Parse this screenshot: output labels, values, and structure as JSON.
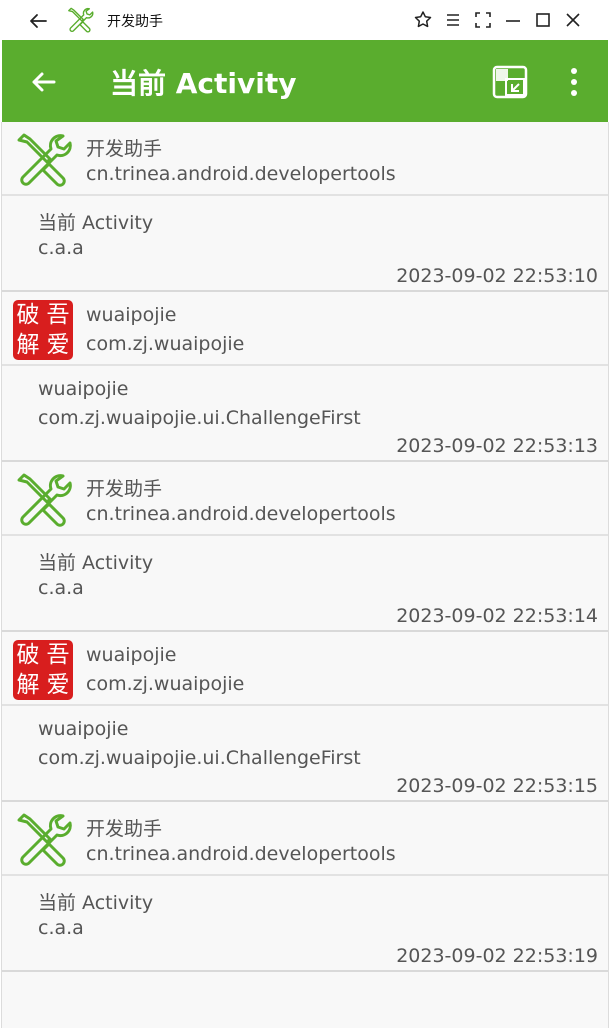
{
  "window": {
    "title": "开发助手",
    "icons": [
      "back-arrow-icon",
      "tools-icon",
      "pin-icon",
      "menu-icon",
      "fullscreen-icon",
      "minimize-icon",
      "maximize-icon",
      "close-icon"
    ]
  },
  "toolbar": {
    "title": "当前 Activity",
    "icons": [
      "back-arrow-icon",
      "floating-window-icon",
      "more-vert-icon"
    ]
  },
  "colors": {
    "toolbar_bg": "#5aad2e",
    "tools_icon": "#5aad2e",
    "seal_red": "#d81e1e"
  },
  "entries": [
    {
      "app_name": "开发助手",
      "package": "cn.trinea.android.developertools",
      "icon": "tools-icon",
      "activity_label": "当前 Activity",
      "activity_class": "c.a.a",
      "time": "2023-09-02 22:53:10"
    },
    {
      "app_name": "wuaipojie",
      "package": "com.zj.wuaipojie",
      "icon": "seal-icon",
      "seal_text": "破吾解爱",
      "activity_label": "wuaipojie",
      "activity_class": "com.zj.wuaipojie.ui.ChallengeFirst",
      "time": "2023-09-02 22:53:13"
    },
    {
      "app_name": "开发助手",
      "package": "cn.trinea.android.developertools",
      "icon": "tools-icon",
      "activity_label": "当前 Activity",
      "activity_class": "c.a.a",
      "time": "2023-09-02 22:53:14"
    },
    {
      "app_name": "wuaipojie",
      "package": "com.zj.wuaipojie",
      "icon": "seal-icon",
      "seal_text": "破吾解爱",
      "activity_label": "wuaipojie",
      "activity_class": "com.zj.wuaipojie.ui.ChallengeFirst",
      "time": "2023-09-02 22:53:15"
    },
    {
      "app_name": "开发助手",
      "package": "cn.trinea.android.developertools",
      "icon": "tools-icon",
      "activity_label": "当前 Activity",
      "activity_class": "c.a.a",
      "time": "2023-09-02 22:53:19"
    }
  ]
}
